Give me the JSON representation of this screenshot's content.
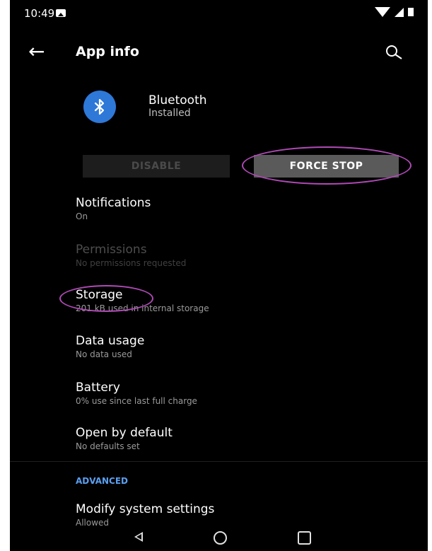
{
  "status_bar": {
    "time": "10:49",
    "notification_icon": "image-icon",
    "icons": [
      "wifi-icon",
      "signal-icon",
      "battery-icon"
    ]
  },
  "app_bar": {
    "back_icon": "arrow-left-icon",
    "title": "App info",
    "search_icon": "search-icon"
  },
  "app": {
    "icon": "bluetooth-icon",
    "name": "Bluetooth",
    "status": "Installed",
    "icon_color": "#2e78d8"
  },
  "actions": {
    "disable_label": "DISABLE",
    "force_stop_label": "FORCE STOP"
  },
  "settings": [
    {
      "title": "Notifications",
      "subtitle": "On"
    },
    {
      "title": "Permissions",
      "subtitle": "No permissions requested"
    },
    {
      "title": "Storage",
      "subtitle": "201 kB used in internal storage"
    },
    {
      "title": "Data usage",
      "subtitle": "No data used"
    },
    {
      "title": "Battery",
      "subtitle": "0% use since last full charge"
    },
    {
      "title": "Open by default",
      "subtitle": "No defaults set"
    }
  ],
  "advanced": {
    "header": "ADVANCED",
    "items": [
      {
        "title": "Modify system settings",
        "subtitle": "Allowed"
      }
    ]
  },
  "nav_bar": {
    "icons": [
      "nav-back-icon",
      "nav-home-icon",
      "nav-recents-icon"
    ]
  },
  "annotation_color": "#b04ab7",
  "accent_color": "#5b9ff0"
}
